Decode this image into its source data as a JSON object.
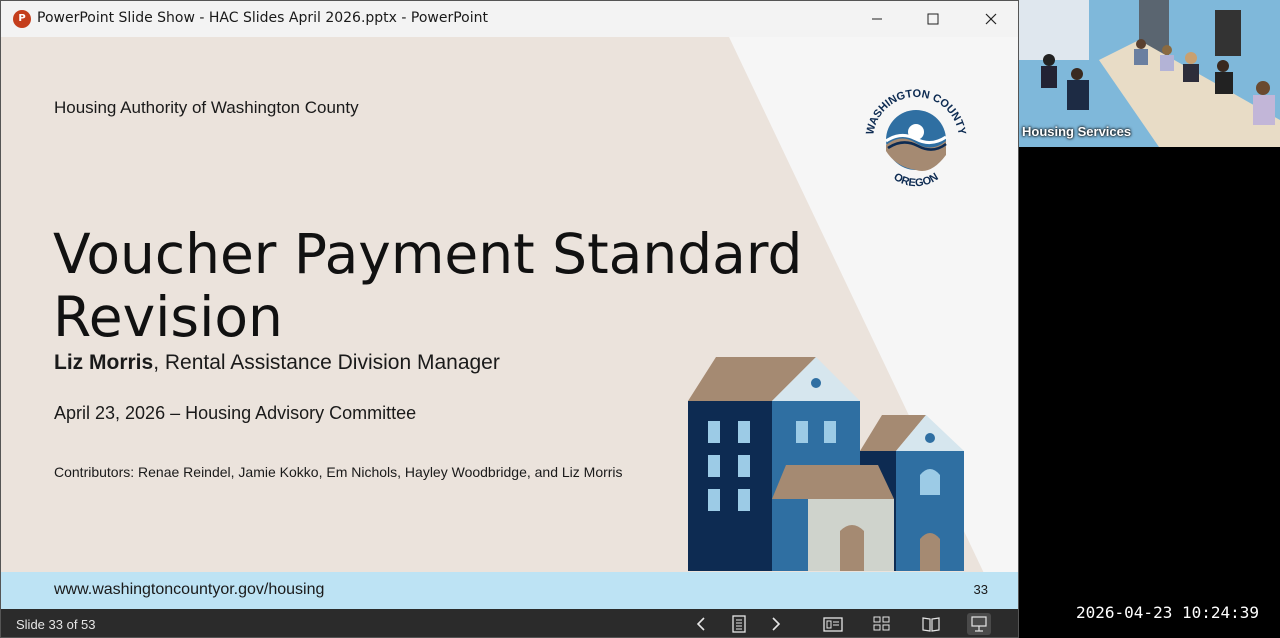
{
  "window": {
    "title": "PowerPoint Slide Show  -  HAC Slides April 2026.pptx - PowerPoint",
    "app_icon_letter": "P"
  },
  "slide": {
    "org_name": "Housing Authority of Washington County",
    "title_line1": "Voucher Payment Standard",
    "title_line2": "Revision",
    "presenter_name": "Liz Morris",
    "presenter_role": ", Rental Assistance Division Manager",
    "date_line": "April 23, 2026 – Housing Advisory Committee",
    "contributors": "Contributors: Renae Reindel, Jamie Kokko, Em Nichols, Hayley Woodbridge, and Liz Morris",
    "logo_top_text": "WASHINGTON COUNTY",
    "logo_bottom_text": "OREGON",
    "footer_url": "www.washingtoncountyor.gov/housing",
    "slide_number": "33"
  },
  "bottombar": {
    "counter": "Slide 33 of 53"
  },
  "video": {
    "label": "Housing Services"
  },
  "overlay": {
    "timestamp": "2026-04-23  10:24:39"
  },
  "colors": {
    "slide_bg": "#ebe3dc",
    "footer_band": "#bde3f4",
    "navy": "#0d2b52",
    "blue": "#2f6fa2",
    "light_blue": "#9ccbe6",
    "tan": "#a58a72"
  }
}
